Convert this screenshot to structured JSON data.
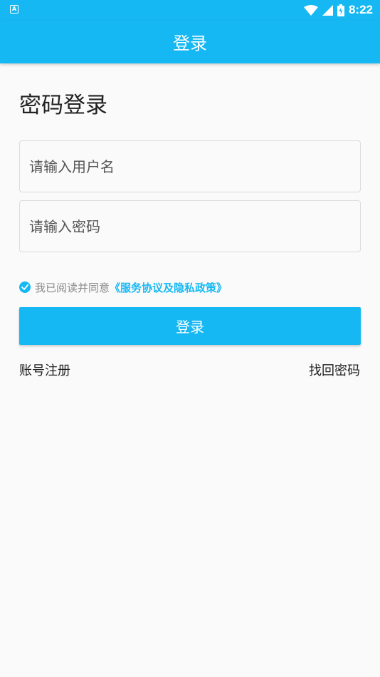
{
  "status_bar": {
    "notification_icon": "A",
    "time": "8:22",
    "icons": [
      "wifi-icon",
      "signal-icon",
      "battery-icon"
    ]
  },
  "app_bar": {
    "title": "登录"
  },
  "login": {
    "heading": "密码登录",
    "username_placeholder": "请输入用户名",
    "username_value": "",
    "password_placeholder": "请输入密码",
    "password_value": "",
    "agreement_checked": true,
    "agreement_text": "我已阅读并同意",
    "agreement_link": "《服务协议及隐私政策》",
    "login_button": "登录",
    "register_link": "账号注册",
    "forgot_link": "找回密码"
  },
  "colors": {
    "primary": "#16b8f3",
    "background": "#fafafa",
    "text": "#222222",
    "muted_text": "#8a8a8a"
  }
}
